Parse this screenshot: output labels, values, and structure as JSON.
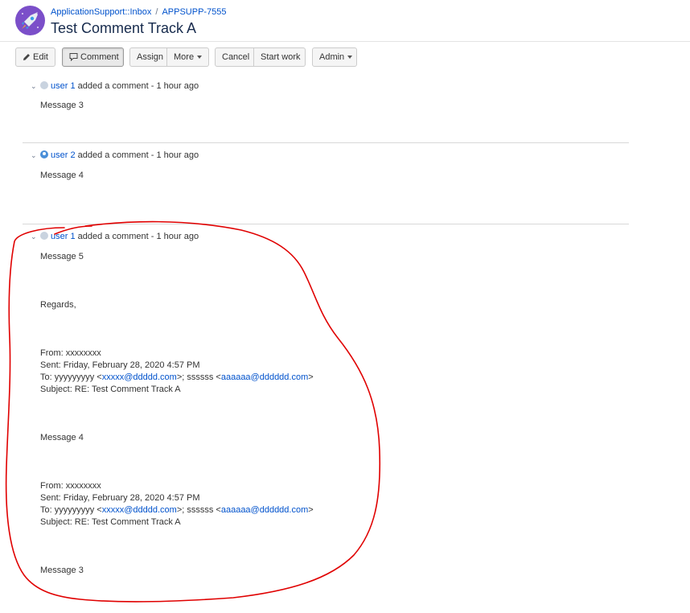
{
  "header": {
    "breadcrumb_project": "ApplicationSupport::Inbox",
    "breadcrumb_sep": "/",
    "breadcrumb_issue": "APPSUPP-7555",
    "title": "Test Comment Track A"
  },
  "toolbar": {
    "edit": "Edit",
    "comment": "Comment",
    "assign": "Assign",
    "more": "More",
    "cancel": "Cancel",
    "start_work": "Start work",
    "admin": "Admin"
  },
  "comments": [
    {
      "user": "user 1",
      "action": "added a comment - 1 hour ago",
      "body": "Message 3"
    },
    {
      "user": "user 2",
      "action": "added a comment - 1 hour ago",
      "body": "Message 4"
    },
    {
      "user": "user 1",
      "action": "added a comment - 1 hour ago",
      "lines": {
        "msg5": "Message 5",
        "regards": "Regards,",
        "from": "From: xxxxxxxx",
        "sent": "Sent: Friday, February 28, 2020 4:57 PM",
        "to_prefix": "To: yyyyyyyyy <",
        "to_email1": "xxxxx@ddddd.com",
        "to_mid": ">; ssssss <",
        "to_email2": "aaaaaa@dddddd.com",
        "to_suffix": ">",
        "subject": "Subject: RE: Test Comment Track A",
        "msg4": "Message 4",
        "from2": "From: xxxxxxxx",
        "sent2": "Sent: Friday, February 28, 2020 4:57 PM",
        "subject2": "Subject: RE: Test Comment Track A",
        "msg3": "Message 3"
      }
    }
  ],
  "annotation_color": "#e00000"
}
